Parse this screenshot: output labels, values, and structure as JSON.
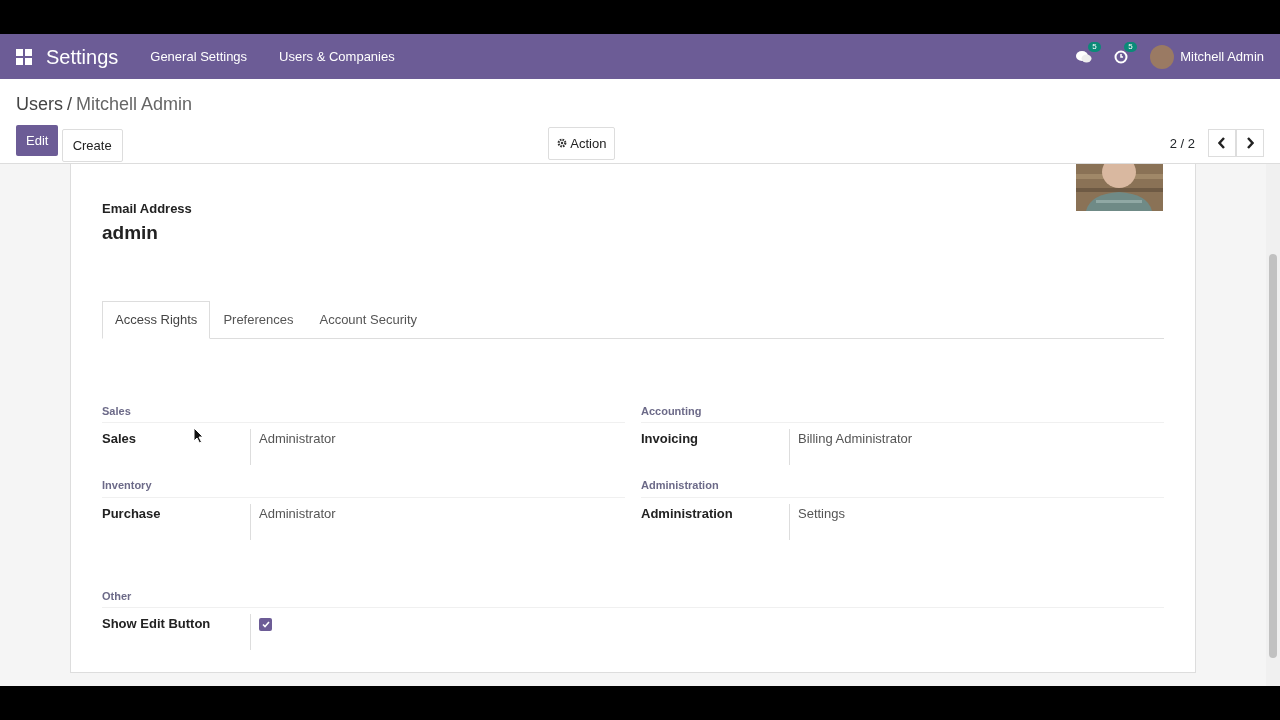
{
  "navbar": {
    "app_name": "Settings",
    "menu": [
      {
        "label": "General Settings"
      },
      {
        "label": "Users & Companies"
      }
    ],
    "messages_count": "5",
    "activities_count": "5",
    "user": "Mitchell Admin"
  },
  "breadcrumb_separator": "/",
  "breadcrumb": [
    {
      "label": "Users",
      "kind": "link"
    },
    {
      "label": "Mitchell Admin",
      "kind": "current"
    }
  ],
  "buttons": [
    {
      "label": "Edit",
      "kind": "primary"
    },
    {
      "label": "Create",
      "kind": "secondary"
    }
  ],
  "action": {
    "label": "Action"
  },
  "pager": {
    "counter": "2 / 2"
  },
  "form": {
    "email_label": "Email Address",
    "email": "admin",
    "tabs": [
      {
        "label": "Access Rights",
        "selected": true
      },
      {
        "label": "Preferences",
        "selected": false
      },
      {
        "label": "Account Security",
        "selected": false
      }
    ],
    "groups": [
      {
        "title": "Sales",
        "fields": [
          {
            "label": "Sales",
            "kind": "select",
            "value": "Administrator"
          }
        ]
      },
      {
        "title": "Accounting",
        "fields": [
          {
            "label": "Invoicing",
            "kind": "select",
            "value": "Billing Administrator"
          }
        ]
      },
      {
        "title": "Inventory",
        "fields": [
          {
            "label": "Purchase",
            "kind": "select",
            "value": "Administrator"
          }
        ]
      },
      {
        "title": "Administration",
        "fields": [
          {
            "label": "Administration",
            "kind": "select",
            "value": "Settings"
          }
        ]
      },
      {
        "title": "Other",
        "wide": true,
        "fields": [
          {
            "label": "Show Edit Button",
            "kind": "checkbox",
            "checked": true
          }
        ]
      }
    ]
  }
}
